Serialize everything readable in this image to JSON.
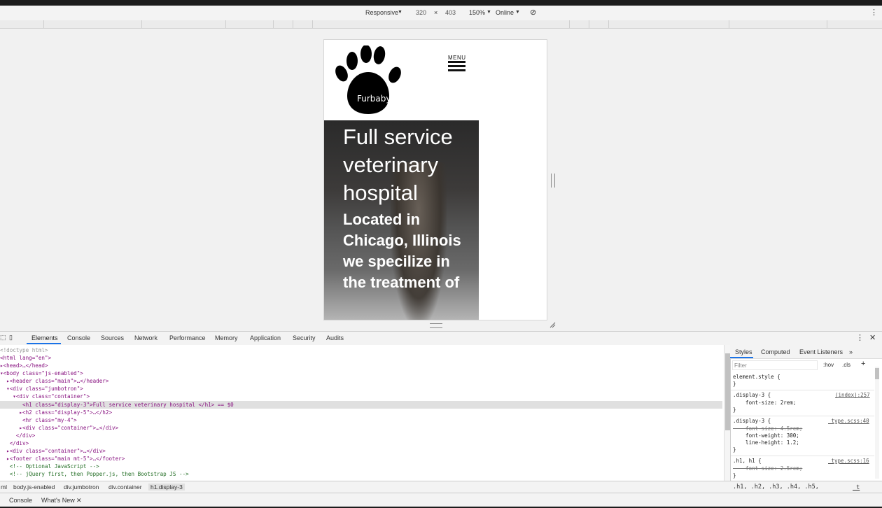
{
  "device_toolbar": {
    "mode": "Responsive",
    "width": "320",
    "times": "×",
    "height": "403",
    "zoom": "150%",
    "network": "Online"
  },
  "site": {
    "brand": "Furbaby",
    "menu_label": "MENU",
    "h1": "Full service veterinary hospital",
    "h2": "Located in Chicago, Illinois we specilize in the treatment of"
  },
  "devtools_tabs": [
    "Elements",
    "Console",
    "Sources",
    "Network",
    "Performance",
    "Memory",
    "Application",
    "Security",
    "Audits"
  ],
  "dom_lines": [
    "<!doctype html>",
    "<html lang=\"en\">",
    "▸<head>…</head>",
    "▾<body class=\"js-enabled\">",
    "  ▸<header class=\"main\">…</header>",
    "  ▾<div class=\"jumbotron\">",
    "    ▾<div class=\"container\">",
    "       <h1 class=\"display-3\">Full service veterinary hospital </h1> == $0",
    "      ▸<h2 class=\"display-5\">…</h2>",
    "       <hr class=\"my-4\">",
    "      ▸<div class=\"container\">…</div>",
    "     </div>",
    "   </div>",
    "  ▸<div class=\"container\">…</div>",
    "  ▸<footer class=\"main mt-5\">…</footer>",
    "   <!-- Optional JavaScript -->",
    "   <!-- jQuery first, then Popper.js, then Bootstrap JS -->"
  ],
  "styles": {
    "tabs": [
      "Styles",
      "Computed",
      "Event Listeners",
      "»"
    ],
    "filter_placeholder": "Filter",
    "hov": ":hov",
    "cls": ".cls",
    "plus": "+",
    "lines": [
      "element.style {",
      "}",
      ".display-3 {",
      "    font-size: 2rem;",
      "}",
      ".display-3 {",
      "    font-size: 4.5rem;",
      "    font-weight: 300;",
      "    line-height: 1.2;",
      "}",
      ".h1, h1 {",
      "    font-size: 2.5rem;",
      "}",
      ".h1, .h2, .h3, .h4, .h5,"
    ],
    "sources": [
      "(index):257",
      "_type.scss:40",
      "_type.scss:16",
      "_t"
    ]
  },
  "breadcrumb": [
    "ml",
    "body.js-enabled",
    "div.jumbotron",
    "div.container",
    "h1.display-3"
  ],
  "drawer_tabs": [
    "Console",
    "What's New"
  ],
  "colors": {
    "accent": "#1a73e8",
    "tag": "#881280"
  }
}
